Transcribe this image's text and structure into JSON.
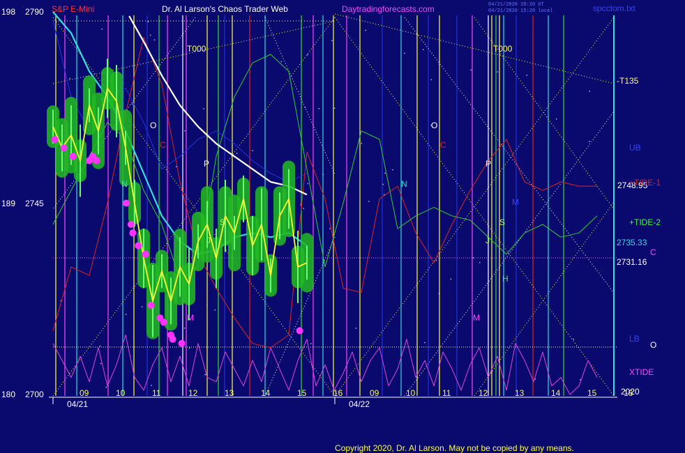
{
  "header": {
    "symbol": "S&P E-Mini",
    "title": "Dr. Al Larson's Chaos Trader Web",
    "site": "Daytradingforecasts.com",
    "stamp1": "04/21/2020 20:20 UT",
    "stamp2": "04/21/2020 15:20 local",
    "file": "spcctom.txt"
  },
  "footer": {
    "copyright": "Copyright 2020, Dr. Al Larson. May not be copied by any means."
  },
  "colors": {
    "background": "#0a0a6e",
    "price_bars": "#33dd33",
    "glow": "#22bb22",
    "white_line": "#ffffff",
    "cyan_line": "#33dddd",
    "yellow_line": "#ffff33",
    "red_band": "#dd2222",
    "green_line": "#33cc33",
    "blue_band": "#2233dd",
    "xtide": "#dd44dd",
    "dots": "#ff33ff"
  },
  "chart_data": {
    "type": "line",
    "title": "S&P E-Mini",
    "y_left_prices": [
      "2790",
      "2745",
      "2700"
    ],
    "y_left_bars": [
      "198",
      "189",
      "180"
    ],
    "ylim": [
      2700,
      2790
    ],
    "x_hours": [
      "09",
      "10",
      "11",
      "12",
      "13",
      "14",
      "15",
      "16",
      "09",
      "10",
      "11",
      "12",
      "13",
      "14",
      "15",
      "16"
    ],
    "dates": [
      "04/21",
      "04/22"
    ],
    "right_labels": [
      {
        "text": "-T135",
        "color": "#ffff66"
      },
      {
        "text": "UB",
        "color": "#3344ff"
      },
      {
        "text": "2748.95",
        "color": "#ffffff"
      },
      {
        "text": "+TIDE-1",
        "color": "#dd2222"
      },
      {
        "text": "+TIDE-2",
        "color": "#33ff33"
      },
      {
        "text": "2735.33",
        "color": "#33dddd"
      },
      {
        "text": "C",
        "color": "#ff44ff"
      },
      {
        "text": "2731.16",
        "color": "#ffffff"
      },
      {
        "text": "LB",
        "color": "#3344ff"
      },
      {
        "text": "O",
        "color": "#ffffff"
      },
      {
        "text": "XTIDE",
        "color": "#ff44ff"
      },
      {
        "text": "2020",
        "color": "#ffffff"
      }
    ],
    "chart_labels": [
      {
        "text": "T000",
        "color": "#ffff66"
      },
      {
        "text": "T000",
        "color": "#ffff66"
      },
      {
        "text": "O",
        "color": "#ffffff"
      },
      {
        "text": "O",
        "color": "#ffffff"
      },
      {
        "text": "C",
        "color": "#dd2222"
      },
      {
        "text": "C",
        "color": "#dd2222"
      },
      {
        "text": "N",
        "color": "#33dddd"
      },
      {
        "text": "N",
        "color": "#33dddd"
      },
      {
        "text": "P",
        "color": "#ffffff"
      },
      {
        "text": "P",
        "color": "#ffffff"
      },
      {
        "text": "S",
        "color": "#aaff66"
      },
      {
        "text": "S",
        "color": "#aaff66"
      },
      {
        "text": "M",
        "color": "#ff44ff"
      },
      {
        "text": "M",
        "color": "#ff44ff"
      },
      {
        "text": "J",
        "color": "#aaff66"
      },
      {
        "text": "J",
        "color": "#aaff66"
      },
      {
        "text": "H",
        "color": "#33ff33"
      },
      {
        "text": "M",
        "color": "#3344ff"
      }
    ],
    "series": [
      {
        "name": "price",
        "x": [
          0.0,
          0.25,
          0.5,
          0.75,
          1.0,
          1.25,
          1.5,
          1.75,
          2.0,
          2.25,
          2.5,
          2.75,
          3.0,
          3.25,
          3.5,
          3.75,
          4.0,
          4.25,
          4.5,
          4.75,
          5.0,
          5.25,
          5.5,
          5.75,
          6.0,
          6.25,
          6.5,
          6.75,
          7.0
        ],
        "values": [
          2763,
          2758,
          2761,
          2755,
          2768,
          2762,
          2772,
          2769,
          2758,
          2745,
          2732,
          2722,
          2729,
          2722,
          2730,
          2726,
          2736,
          2740,
          2732,
          2742,
          2738,
          2746,
          2735,
          2740,
          2728,
          2742,
          2746,
          2730,
          2731
        ]
      },
      {
        "name": "white",
        "x": [
          2.1,
          2.5,
          3.0,
          3.5,
          4.0,
          4.5,
          5.0,
          5.5,
          6.0,
          6.5,
          7.0
        ],
        "values": [
          2789,
          2783,
          2775,
          2768,
          2763,
          2759,
          2756,
          2753,
          2750,
          2749,
          2747
        ]
      },
      {
        "name": "cyan",
        "x": [
          0.0,
          0.5,
          1.0,
          1.5,
          2.0,
          2.5,
          3.0,
          3.5,
          4.0,
          4.5,
          5.0,
          5.5,
          6.0,
          6.5,
          7.0
        ],
        "values": [
          2790,
          2785,
          2776,
          2770,
          2762,
          2752,
          2742,
          2736,
          2733,
          2734,
          2737,
          2738,
          2737,
          2738,
          2735
        ]
      },
      {
        "name": "blue",
        "x": [
          0.0,
          0.5,
          1.0,
          1.5,
          2.0,
          2.5,
          3.0,
          3.5,
          4.0,
          4.5,
          5.0,
          5.5,
          6.0,
          6.5,
          7.0
        ],
        "values": [
          2788,
          2770,
          2762,
          2770,
          2772,
          2764,
          2753,
          2756,
          2760,
          2762,
          2759,
          2755,
          2752,
          2750,
          2752
        ]
      },
      {
        "name": "+TIDE-1",
        "x": [
          0.0,
          0.5,
          1.0,
          1.5,
          2.0,
          2.5,
          3.0,
          3.5,
          4.0,
          4.5,
          5.0,
          5.5,
          6.0,
          6.5,
          7.0,
          7.5,
          8.0,
          8.5,
          9.0,
          9.5,
          10.0,
          10.5,
          11.0,
          11.5,
          12.0,
          12.5,
          13.0,
          13.5,
          14.0,
          14.5,
          15.0
        ],
        "values": [
          2715,
          2730,
          2728,
          2745,
          2766,
          2784,
          2773,
          2750,
          2733,
          2725,
          2718,
          2712,
          2711,
          2714,
          2757,
          2746,
          2725,
          2724,
          2746,
          2749,
          2738,
          2731,
          2740,
          2748,
          2755,
          2760,
          2750,
          2748,
          2750,
          2749,
          2749
        ]
      },
      {
        "name": "+TIDE-2",
        "x": [
          0.0,
          0.5,
          1.0,
          1.5,
          2.0,
          2.5,
          3.0,
          3.5,
          4.0,
          4.5,
          5.0,
          5.5,
          6.0,
          6.5,
          7.0,
          7.5,
          8.0,
          8.5,
          9.0,
          9.5,
          10.0,
          10.5,
          11.0,
          11.5,
          12.0,
          12.5,
          13.0,
          13.5,
          14.0,
          14.5,
          15.0
        ],
        "values": [
          2740,
          2748,
          2756,
          2764,
          2760,
          2748,
          2740,
          2727,
          2730,
          2756,
          2770,
          2778,
          2780,
          2776,
          2753,
          2730,
          2745,
          2762,
          2760,
          2739,
          2742,
          2744,
          2742,
          2741,
          2737,
          2733,
          2738,
          2740,
          2737,
          2738,
          2742
        ]
      },
      {
        "name": "XTIDE",
        "x": [
          0.0,
          0.25,
          0.5,
          0.75,
          1.0,
          1.25,
          1.5,
          1.75,
          2.0,
          2.25,
          2.5,
          2.75,
          3.0,
          3.25,
          3.5,
          3.75,
          4.0,
          4.25,
          4.5,
          4.75,
          5.0,
          5.25,
          5.5,
          5.75,
          6.0,
          6.25,
          6.5,
          6.75,
          7.0,
          7.25,
          7.5,
          7.75,
          8.0,
          8.25,
          8.5,
          8.75,
          9.0,
          9.25,
          9.5,
          9.75,
          10.0,
          10.25,
          10.5,
          10.75,
          11.0,
          11.25,
          11.5,
          11.75,
          12.0,
          12.25,
          12.5,
          12.75,
          13.0,
          13.25,
          13.5,
          13.75,
          14.0,
          14.25,
          14.5,
          14.75,
          15.0
        ],
        "values": [
          2712,
          2708,
          2704,
          2709,
          2703,
          2711,
          2702,
          2707,
          2714,
          2704,
          2701,
          2707,
          2711,
          2703,
          2709,
          2702,
          2712,
          2704,
          2703,
          2710,
          2706,
          2702,
          2708,
          2703,
          2711,
          2706,
          2701,
          2708,
          2713,
          2702,
          2707,
          2701,
          2705,
          2710,
          2703,
          2708,
          2711,
          2702,
          2706,
          2713,
          2704,
          2708,
          2702,
          2710,
          2706,
          2701,
          2707,
          2711,
          2704,
          2709,
          2701,
          2712,
          2708,
          2703,
          2710,
          2702,
          2704,
          2700,
          2702,
          2708,
          2704
        ]
      }
    ],
    "dots": {
      "x": [
        0.05,
        0.3,
        0.55,
        1.0,
        1.1,
        1.2,
        2.02,
        2.15,
        2.2,
        2.35,
        2.55,
        2.7,
        2.95,
        3.05,
        3.25,
        3.3,
        3.55,
        6.8
      ],
      "values": [
        2760,
        2758,
        2756,
        2755,
        2756,
        2755,
        2745,
        2740,
        2738,
        2735,
        2733,
        2721,
        2718,
        2717,
        2714,
        2713,
        2712,
        2715
      ]
    }
  }
}
